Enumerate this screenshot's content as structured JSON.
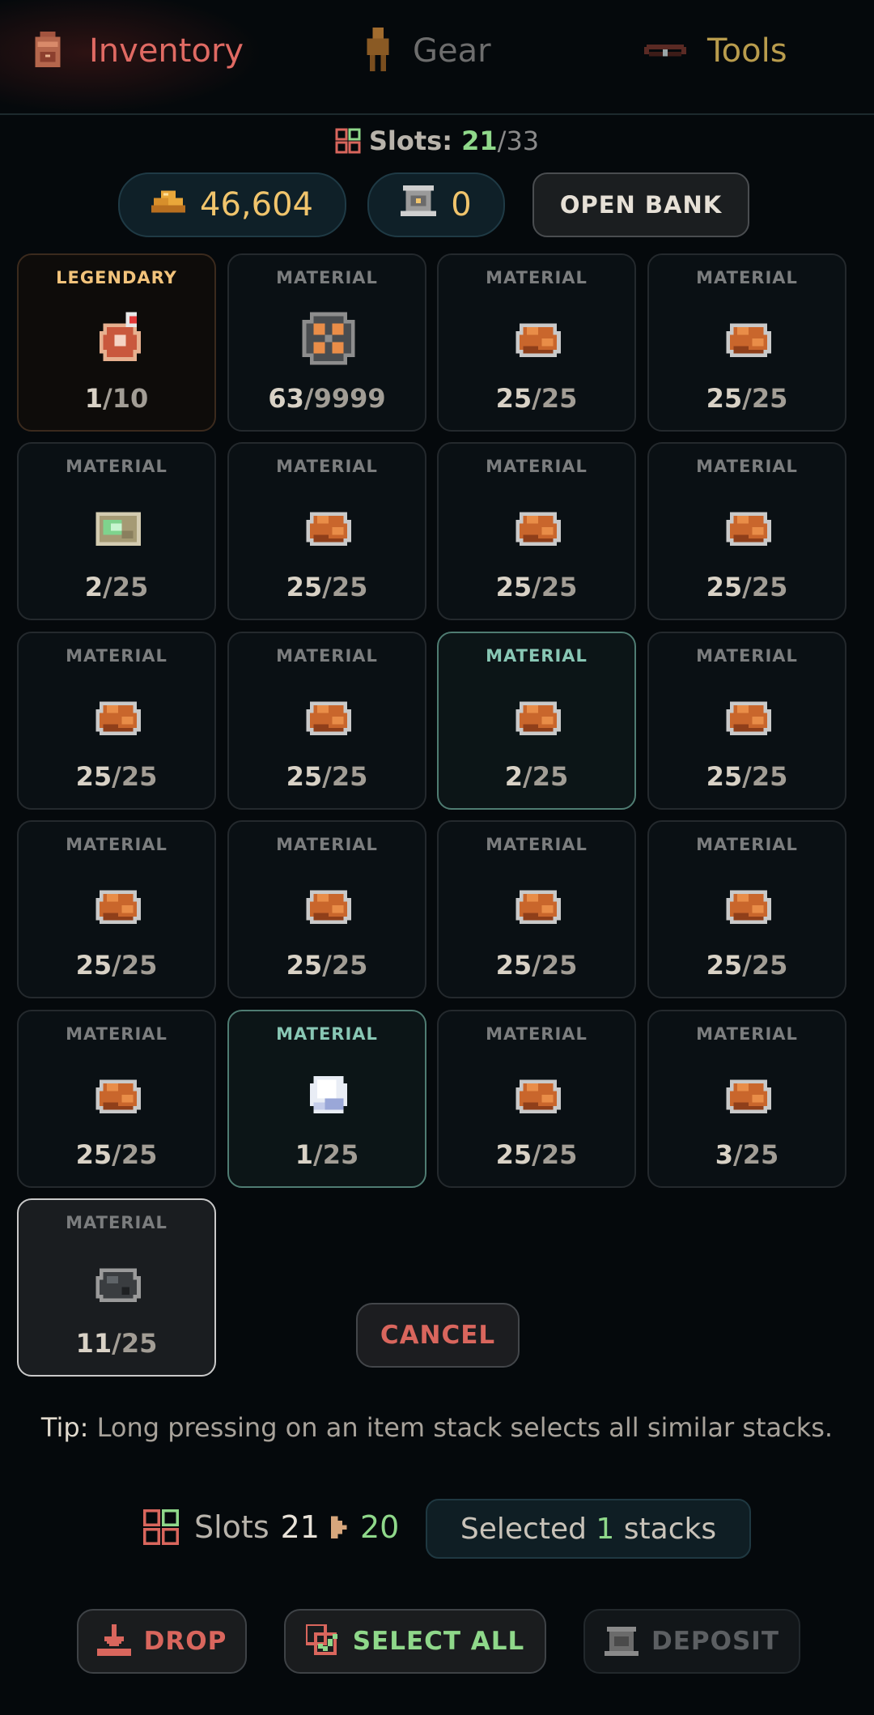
{
  "tabs": [
    {
      "label": "Inventory",
      "icon": "backpack-icon",
      "active": true
    },
    {
      "label": "Gear",
      "icon": "person-icon",
      "active": false
    },
    {
      "label": "Tools",
      "icon": "tool-belt-icon",
      "active": false
    }
  ],
  "slots_header": {
    "label": "Slots:",
    "used": "21",
    "sep_total": "/33"
  },
  "currency": {
    "gold": "46,604",
    "bank_items": "0",
    "open_bank_label": "OPEN BANK"
  },
  "items": [
    {
      "type": "LEGENDARY",
      "count": "1",
      "max": "/10",
      "icon": "amulet-icon",
      "state": "legendary"
    },
    {
      "type": "MATERIAL",
      "count": "63",
      "max": "/9999",
      "icon": "gear-token-icon",
      "state": ""
    },
    {
      "type": "MATERIAL",
      "count": "25",
      "max": "/25",
      "icon": "copper-ore-icon",
      "state": ""
    },
    {
      "type": "MATERIAL",
      "count": "25",
      "max": "/25",
      "icon": "copper-ore-icon",
      "state": ""
    },
    {
      "type": "MATERIAL",
      "count": "2",
      "max": "/25",
      "icon": "green-ore-icon",
      "state": ""
    },
    {
      "type": "MATERIAL",
      "count": "25",
      "max": "/25",
      "icon": "copper-ore-icon",
      "state": ""
    },
    {
      "type": "MATERIAL",
      "count": "25",
      "max": "/25",
      "icon": "copper-ore-icon",
      "state": ""
    },
    {
      "type": "MATERIAL",
      "count": "25",
      "max": "/25",
      "icon": "copper-ore-icon",
      "state": ""
    },
    {
      "type": "MATERIAL",
      "count": "25",
      "max": "/25",
      "icon": "copper-ore-icon",
      "state": ""
    },
    {
      "type": "MATERIAL",
      "count": "25",
      "max": "/25",
      "icon": "copper-ore-icon",
      "state": ""
    },
    {
      "type": "MATERIAL",
      "count": "2",
      "max": "/25",
      "icon": "copper-ore-icon",
      "state": "selected"
    },
    {
      "type": "MATERIAL",
      "count": "25",
      "max": "/25",
      "icon": "copper-ore-icon",
      "state": ""
    },
    {
      "type": "MATERIAL",
      "count": "25",
      "max": "/25",
      "icon": "copper-ore-icon",
      "state": ""
    },
    {
      "type": "MATERIAL",
      "count": "25",
      "max": "/25",
      "icon": "copper-ore-icon",
      "state": ""
    },
    {
      "type": "MATERIAL",
      "count": "25",
      "max": "/25",
      "icon": "copper-ore-icon",
      "state": ""
    },
    {
      "type": "MATERIAL",
      "count": "25",
      "max": "/25",
      "icon": "copper-ore-icon",
      "state": ""
    },
    {
      "type": "MATERIAL",
      "count": "25",
      "max": "/25",
      "icon": "copper-ore-icon",
      "state": ""
    },
    {
      "type": "MATERIAL",
      "count": "1",
      "max": "/25",
      "icon": "white-crystal-icon",
      "state": "selected"
    },
    {
      "type": "MATERIAL",
      "count": "25",
      "max": "/25",
      "icon": "copper-ore-icon",
      "state": ""
    },
    {
      "type": "MATERIAL",
      "count": "3",
      "max": "/25",
      "icon": "copper-ore-icon",
      "state": ""
    },
    {
      "type": "MATERIAL",
      "count": "11",
      "max": "/25",
      "icon": "coal-ore-icon",
      "state": "active"
    }
  ],
  "cancel_label": "CANCEL",
  "tip": {
    "prefix": "Tip:",
    "text": "Long pressing on an item stack selects all similar stacks."
  },
  "slots_change": {
    "label": "Slots",
    "from": "21",
    "to": "20"
  },
  "selected": {
    "prefix": "Selected",
    "count": "1",
    "suffix": "stacks"
  },
  "actions": {
    "drop": "DROP",
    "select_all": "SELECT ALL",
    "deposit": "DEPOSIT"
  },
  "colors": {
    "background": "#05090c",
    "accent_red": "#e06a63",
    "accent_green": "#8fd88a",
    "gold": "#f0c46c"
  }
}
